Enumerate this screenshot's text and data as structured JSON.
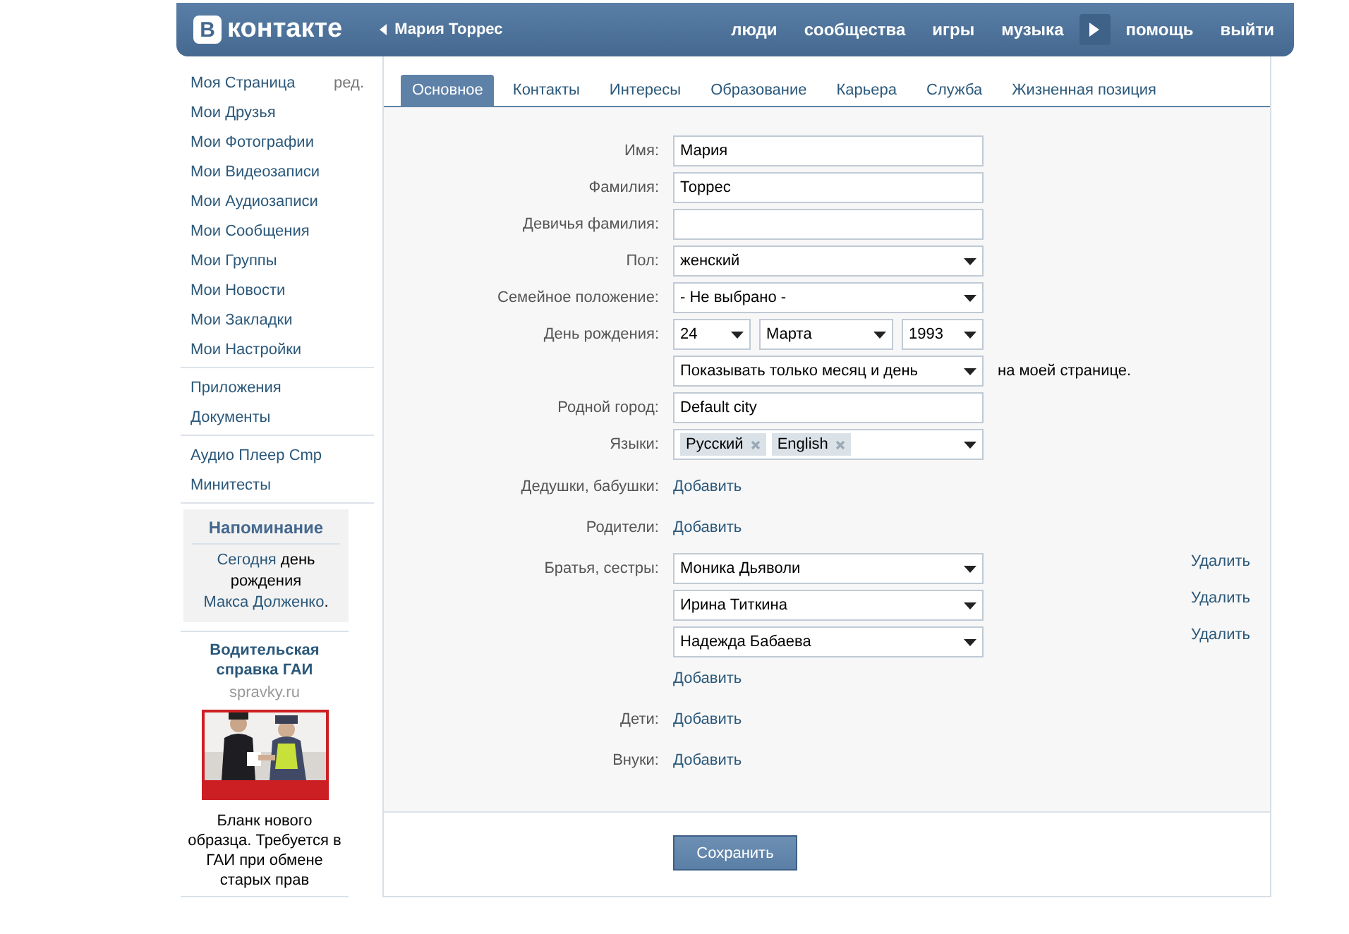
{
  "header": {
    "logo": {
      "mark": "В",
      "text": "контакте"
    },
    "back": "Мария Торрес",
    "nav": [
      {
        "kind": "link",
        "label": "люди"
      },
      {
        "kind": "link",
        "label": "сообщества"
      },
      {
        "kind": "link",
        "label": "игры"
      },
      {
        "kind": "link",
        "label": "музыка"
      },
      {
        "kind": "arrow"
      },
      {
        "kind": "link",
        "label": "помощь"
      },
      {
        "kind": "link",
        "label": "выйти"
      }
    ]
  },
  "sidebar": {
    "groups": [
      [
        {
          "label": "Моя Страница",
          "edit": "ред."
        },
        {
          "label": "Мои Друзья"
        },
        {
          "label": "Мои Фотографии"
        },
        {
          "label": "Мои Видеозаписи"
        },
        {
          "label": "Мои Аудиозаписи"
        },
        {
          "label": "Мои Сообщения"
        },
        {
          "label": "Мои Группы"
        },
        {
          "label": "Мои Новости"
        },
        {
          "label": "Мои Закладки"
        },
        {
          "label": "Мои Настройки"
        }
      ],
      [
        {
          "label": "Приложения"
        },
        {
          "label": "Документы"
        }
      ],
      [
        {
          "label": "Аудио Плеер Cmp"
        },
        {
          "label": "Минитесты"
        }
      ]
    ],
    "reminder": {
      "title": "Напоминание",
      "parts": [
        {
          "text": "Сегодня",
          "link": true
        },
        {
          "text": " день рождения ",
          "link": false
        },
        {
          "text": "Макса Долженко",
          "link": true
        },
        {
          "text": ".",
          "link": false
        }
      ]
    },
    "ad": {
      "title": "Водительская справка ГАИ",
      "domain": "spravky.ru",
      "text": "Бланк нового образца. Требуется в ГАИ при обмене старых прав"
    }
  },
  "tabs": [
    {
      "label": "Основное",
      "selected": true
    },
    {
      "label": "Контакты",
      "selected": false
    },
    {
      "label": "Интересы",
      "selected": false
    },
    {
      "label": "Образование",
      "selected": false
    },
    {
      "label": "Карьера",
      "selected": false
    },
    {
      "label": "Служба",
      "selected": false
    },
    {
      "label": "Жизненная позиция",
      "selected": false
    }
  ],
  "form": {
    "rows": [
      {
        "kind": "text",
        "label": "Имя:",
        "value": "Мария"
      },
      {
        "kind": "text",
        "label": "Фамилия:",
        "value": "Торрес"
      },
      {
        "kind": "text",
        "label": "Девичья фамилия:"
      },
      {
        "kind": "select",
        "label": "Пол:",
        "value": "женский"
      },
      {
        "kind": "select",
        "label": "Семейное положение:",
        "value": "- Не выбрано -"
      },
      {
        "kind": "date",
        "label": "День рождения:",
        "parts": [
          "24",
          "Марта",
          "1993"
        ]
      },
      {
        "kind": "select",
        "value": "Показывать только месяц и день",
        "note": "на моей странице."
      },
      {
        "kind": "text",
        "label": "Родной город:",
        "value": "Default city"
      },
      {
        "kind": "tags",
        "label": "Языки:",
        "tags": [
          "Русский",
          "English"
        ]
      },
      {
        "kind": "add",
        "label": "Дедушки, бабушки:",
        "action": "Добавить"
      },
      {
        "kind": "add",
        "label": "Родители:",
        "action": "Добавить"
      },
      {
        "kind": "list",
        "label": "Братья, сестры:",
        "items": [
          {
            "value": "Моника Дьяволи",
            "remove": "Удалить"
          },
          {
            "value": "Ирина Титкина",
            "remove": "Удалить"
          },
          {
            "value": "Надежда Бабаева",
            "remove": "Удалить"
          }
        ],
        "action": "Добавить"
      },
      {
        "kind": "add",
        "label": "Дети:",
        "action": "Добавить"
      },
      {
        "kind": "add",
        "label": "Внуки:",
        "action": "Добавить"
      }
    ],
    "save": "Сохранить"
  }
}
